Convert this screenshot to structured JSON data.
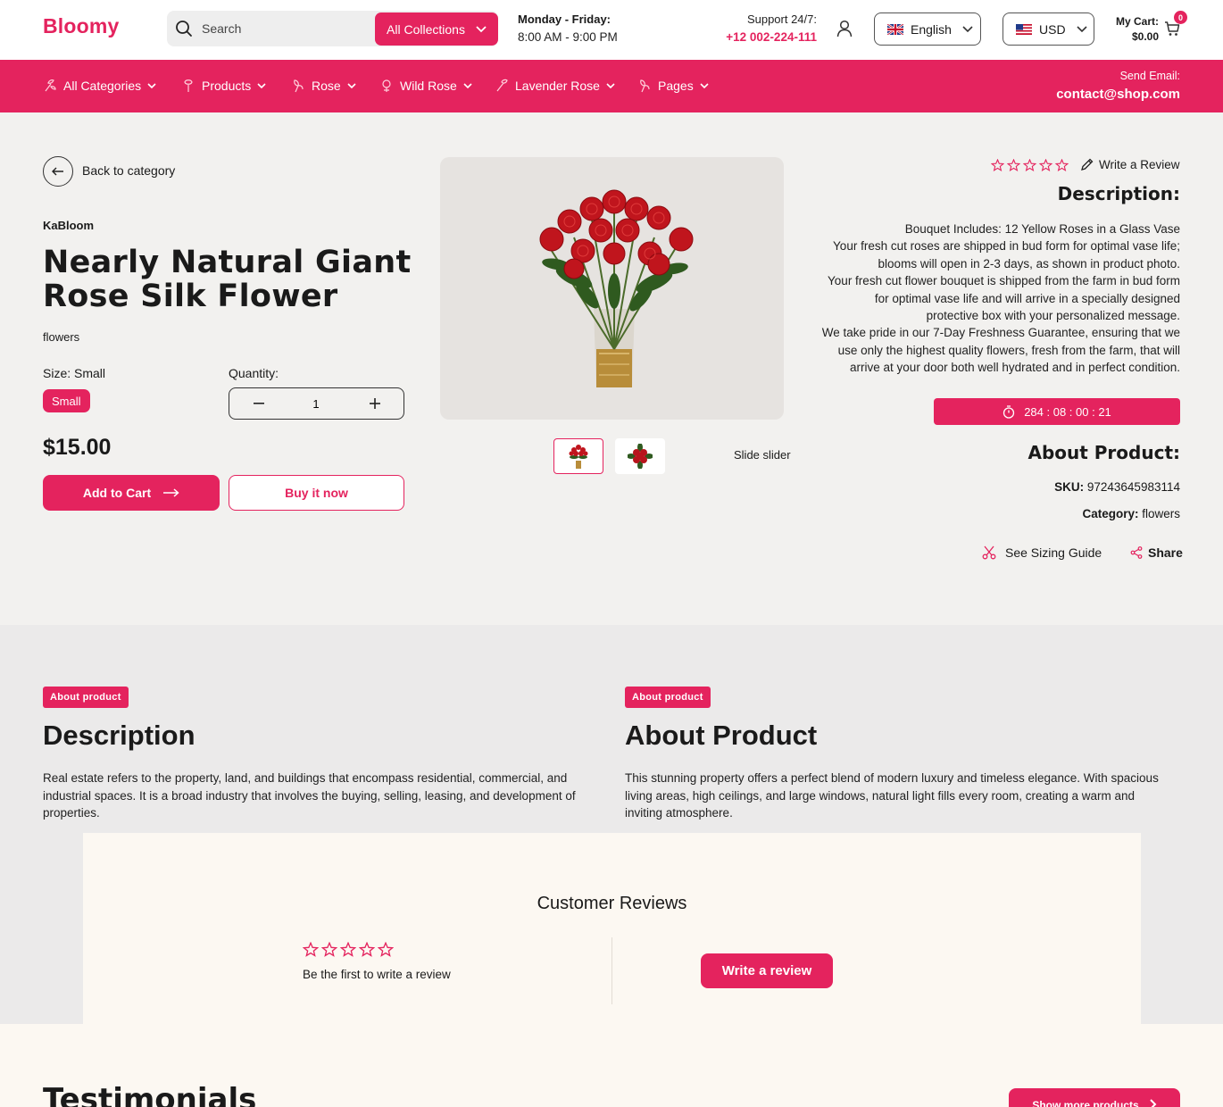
{
  "header": {
    "logo": "Bloomy",
    "search": {
      "placeholder": "Search"
    },
    "collections_label": "All Collections",
    "hours_title": "Monday - Friday:",
    "hours_text": "8:00 AM - 9:00 PM",
    "support_label": "Support 24/7:",
    "support_phone": "+12 002-224-111",
    "language": "English",
    "currency": "USD",
    "cart_label": "My Cart:",
    "cart_value": "$0.00",
    "cart_count": "0"
  },
  "nav": {
    "items": [
      {
        "label": "All Categories"
      },
      {
        "label": "Products"
      },
      {
        "label": "Rose"
      },
      {
        "label": "Wild Rose"
      },
      {
        "label": "Lavender Rose"
      },
      {
        "label": "Pages"
      }
    ],
    "send_label": "Send Email:",
    "send_email": "contact@shop.com"
  },
  "product": {
    "back_label": "Back to category",
    "vendor": "KaBloom",
    "title": "Nearly Natural Giant Rose Silk Flower",
    "type": "flowers",
    "size_label": "Size:  Small",
    "size_option": "Small",
    "quantity_label": "Quantity:",
    "quantity": "1",
    "price": "$15.00",
    "add_to_cart": "Add to Cart",
    "buy_now": "Buy it now",
    "slide_label": "Slide slider"
  },
  "info": {
    "write_review": "Write a Review",
    "description_heading": "Description:",
    "description_lines": [
      "Bouquet Includes: 12 Yellow Roses in a Glass Vase",
      "Your fresh cut roses are shipped in bud form for optimal vase life;",
      "blooms will open in 2-3 days, as shown in product photo.",
      "Your fresh cut flower bouquet is shipped from the farm in bud form",
      "for optimal vase life and will arrive in a specially designed",
      "protective box with your personalized message.",
      "We take pride in our 7-Day Freshness Guarantee, ensuring that we",
      "use only the highest quality flowers, fresh from the farm, that will",
      "arrive at your door both well hydrated and in perfect condition."
    ],
    "timer": "284 : 08 : 00 : 21",
    "about_heading": "About Product:",
    "sku_label": "SKU:",
    "sku_value": "97243645983114",
    "category_label": "Category:",
    "category_value": "flowers",
    "sizing_guide": "See Sizing Guide",
    "share": "Share"
  },
  "lower": {
    "left_tag": "About product",
    "left_title": "Description",
    "left_body": "Real estate refers to the property, land, and buildings that encompass residential, commercial, and industrial spaces. It is a broad industry that involves the buying, selling, leasing, and development of properties.",
    "right_tag": "About product",
    "right_title": "About Product",
    "right_body": "This stunning property offers a perfect blend of modern luxury and timeless elegance. With spacious living areas, high ceilings, and large windows, natural light fills every room, creating a warm and inviting atmosphere."
  },
  "reviews": {
    "title": "Customer Reviews",
    "rating": 0,
    "first_text": "Be the first to write a review",
    "write_button": "Write a review"
  },
  "testimonials": {
    "title": "Testimonials",
    "more_button": "Show more products"
  },
  "colors": {
    "accent": "#e4235e",
    "page_bg": "#f2f1ef",
    "section_bg": "#ebeaea",
    "reviews_bg": "#fcf8f2"
  }
}
